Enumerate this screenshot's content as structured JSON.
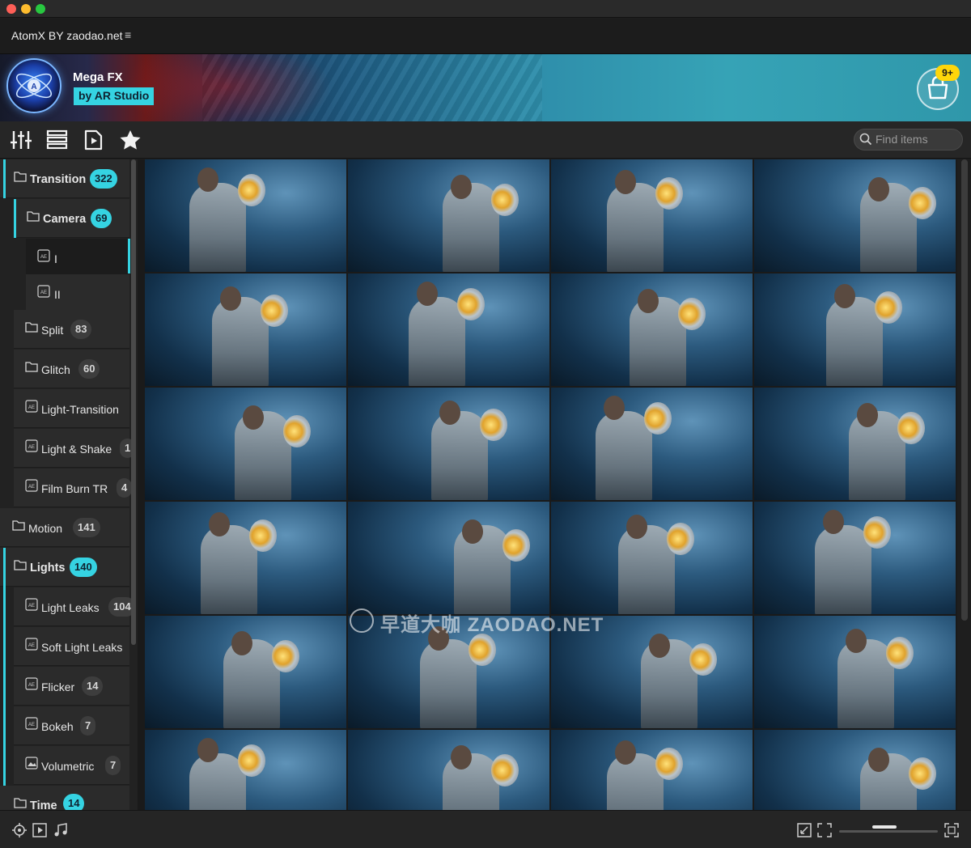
{
  "window": {
    "title": "AtomX BY zaodao.net",
    "menu_icon": "hamburger-icon"
  },
  "banner": {
    "brand_name": "Mega FX",
    "brand_by": "by AR Studio",
    "cart_badge": "9+"
  },
  "toolbar": {
    "search_placeholder": "Find items",
    "tools": [
      "sliders-icon",
      "list-icon",
      "play-file-icon",
      "star-icon"
    ]
  },
  "sidebar": {
    "items": [
      {
        "label": "Transition",
        "count": "322",
        "level": 0,
        "expanded": true
      },
      {
        "label": "Camera",
        "count": "69",
        "level": 1,
        "expanded": true
      },
      {
        "label": "I",
        "count": "",
        "level": 2,
        "selected": true
      },
      {
        "label": "II",
        "count": "",
        "level": 2
      },
      {
        "label": "Split",
        "count": "83",
        "level": 1
      },
      {
        "label": "Glitch",
        "count": "60",
        "level": 1
      },
      {
        "label": "Light-Transition",
        "count": "",
        "level": 1
      },
      {
        "label": "Light & Shake",
        "count": "1",
        "level": 1
      },
      {
        "label": "Film Burn TR",
        "count": "4",
        "level": 1
      },
      {
        "label": "Motion",
        "count": "141",
        "level": 0
      },
      {
        "label": "Lights",
        "count": "140",
        "level": 0,
        "expanded": true
      },
      {
        "label": "Light Leaks",
        "count": "104",
        "level": 1
      },
      {
        "label": "Soft Light Leaks",
        "count": "",
        "level": 1
      },
      {
        "label": "Flicker",
        "count": "14",
        "level": 1
      },
      {
        "label": "Bokeh",
        "count": "7",
        "level": 1
      },
      {
        "label": "Volumetric",
        "count": "7",
        "level": 1
      },
      {
        "label": "Time",
        "count": "14",
        "level": 0
      }
    ]
  },
  "grid": {
    "rows": 6,
    "cols": 4
  },
  "watermark": {
    "text": "早道大咖 ZAODAO.NET"
  },
  "bottombar": {
    "left_icons": [
      "target-icon",
      "play-box-icon",
      "music-note-icon"
    ],
    "right_icons": [
      "shrink-icon",
      "expand-corners-icon",
      "fullscreen-icon"
    ],
    "zoom_level": 0.45
  },
  "colors": {
    "accent": "#35d3e2",
    "badge_gray": "#3d3d3d",
    "cart_badge": "#ffd60a"
  }
}
